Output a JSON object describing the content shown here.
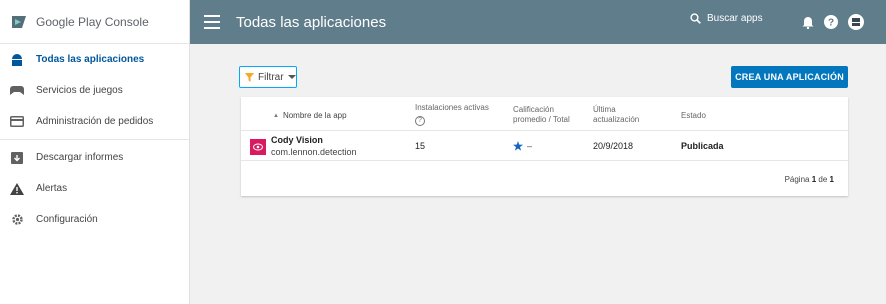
{
  "sidebar": {
    "brand_google": "Google Play",
    "brand_console": "Console",
    "items": [
      {
        "label": "Todas las aplicaciones",
        "icon": "android-icon"
      },
      {
        "label": "Servicios de juegos",
        "icon": "gamepad-icon"
      },
      {
        "label": "Administración de pedidos",
        "icon": "credit-card-icon"
      },
      {
        "label": "Descargar informes",
        "icon": "download-icon"
      },
      {
        "label": "Alertas",
        "icon": "warning-icon"
      },
      {
        "label": "Configuración",
        "icon": "gear-icon"
      }
    ]
  },
  "topbar": {
    "title": "Todas las aplicaciones",
    "search_label": "Buscar apps"
  },
  "toolbar": {
    "filter_label": "Filtrar",
    "create_label": "CREA UNA APLICACIÓN"
  },
  "table": {
    "headers": {
      "name": "Nombre de la app",
      "installs": "Instalaciones activas",
      "rating_line1": "Calificación",
      "rating_line2": "promedio / Total",
      "updated_line1": "Última",
      "updated_line2": "actualización",
      "state": "Estado"
    },
    "rows": [
      {
        "name": "Cody Vision",
        "package": "com.lennon.detection",
        "installs": "15",
        "rating": "–",
        "updated": "20/9/2018",
        "state": "Publicada"
      }
    ],
    "pager": {
      "prefix": "Página",
      "current": "1",
      "middle": "de",
      "total": "1"
    }
  },
  "colors": {
    "topbar": "#607d8b",
    "accent": "#0277bd",
    "active_nav": "#01579b",
    "app_icon": "#d81b60"
  }
}
